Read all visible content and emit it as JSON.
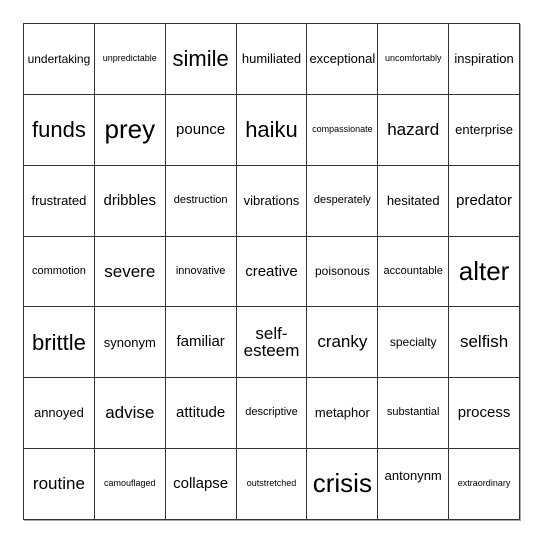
{
  "board": {
    "rows": [
      [
        "undertaking",
        "unpredictable",
        "simile",
        "humiliated",
        "exceptional",
        "uncomfortably",
        "inspiration"
      ],
      [
        "funds",
        "prey",
        "pounce",
        "haiku",
        "compassionate",
        "hazard",
        "enterprise"
      ],
      [
        "frustrated",
        "dribbles",
        "destruction",
        "vibrations",
        "desperately",
        "hesitated",
        "predator"
      ],
      [
        "commotion",
        "severe",
        "innovative",
        "creative",
        "poisonous",
        "accountable",
        "alter"
      ],
      [
        "brittle",
        "synonym",
        "familiar",
        "self-esteem",
        "cranky",
        "specialty",
        "selfish"
      ],
      [
        "annoyed",
        "advise",
        "attitude",
        "descriptive",
        "metaphor",
        "substantial",
        "process"
      ],
      [
        "routine",
        "camouflaged",
        "collapse",
        "outstretched",
        "crisis",
        "antonynm",
        "extraordinary"
      ]
    ]
  }
}
